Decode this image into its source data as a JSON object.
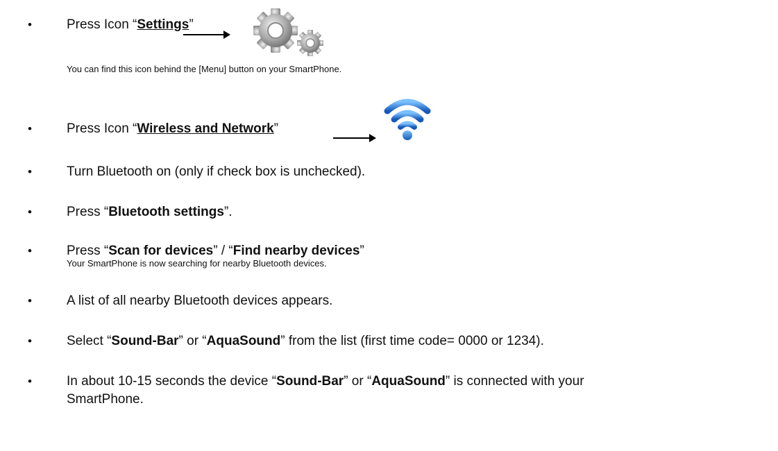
{
  "steps": [
    {
      "pre": "Press Icon  “",
      "bold": "Settings",
      "post": "”"
    },
    {
      "pre": "Press Icon “",
      "bold": "Wireless and Network",
      "post": "”"
    },
    {
      "text": "Turn Bluetooth on (only if check box is unchecked)."
    },
    {
      "pre": "Press “",
      "bold": "Bluetooth settings",
      "post": "”."
    },
    {
      "pre": "Press “",
      "bold1": "Scan for devices",
      "mid": "” /  “",
      "bold2": "Find nearby devices",
      "post": "”"
    },
    {
      "text": "A list of all nearby Bluetooth devices appears."
    },
    {
      "pre": "Select “",
      "bold1": "Sound-Bar",
      "mid": "” or “",
      "bold2": "AquaSound",
      "post": "”  from the list (first time code= 0000 or 1234)."
    },
    {
      "pre": "In about 10-15 seconds the device “",
      "bold1": "Sound-Bar",
      "mid": "” or “",
      "bold2": "AquaSound",
      "post": "” is connected with your",
      "line2": "SmartPhone."
    }
  ],
  "notes": {
    "settings": "You can find this icon behind the [Menu] button on your SmartPhone.",
    "scan": "Your SmartPhone is now searching for nearby Bluetooth devices."
  },
  "bullet": "•",
  "icons": {
    "settings": "gear-icon",
    "wireless": "wifi-icon"
  },
  "colors": {
    "text": "#111111",
    "gear": "#9a9a9a",
    "wifi": "#1e6fd0"
  }
}
